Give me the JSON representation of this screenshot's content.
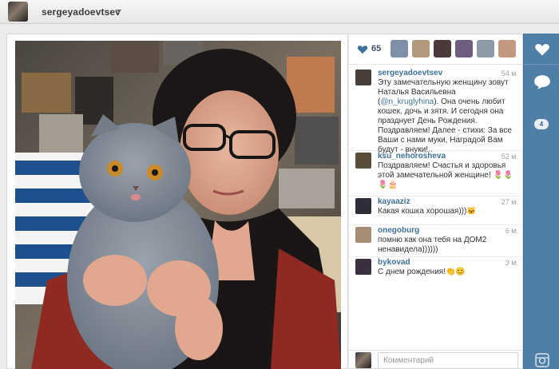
{
  "header": {
    "username": "sergeyadoevtsev"
  },
  "likes": {
    "count": "65",
    "likers": [
      {
        "color": "#7e8fa6"
      },
      {
        "color": "#b39a7c"
      },
      {
        "color": "#4c3a3a"
      },
      {
        "color": "#6f5d80"
      },
      {
        "color": "#8c9aa8"
      },
      {
        "color": "#c49880"
      },
      {
        "color": "#b36a58"
      },
      {
        "color": "#d9d9d9"
      }
    ]
  },
  "comments": [
    {
      "user": "sergeyadoevtsev",
      "time": "54 м.",
      "text_before": "Эту замечательную женщину зовут Наталья Васильевна (",
      "mention": "@n_kruglyhina",
      "text_after": "). Она очень любит кошек, дочь и зятя. И сегодня она празднует День Рождения. Поздравляем! Далее - стихи: За все Ваши с нами муки, Наградой Вам будут - внуки!..",
      "avatar_color": "#4a3f38"
    },
    {
      "user": "ksu_nehorosheva",
      "time": "52 м.",
      "text": "Поздравляем! Счастья и здоровья этой замечательной женщине! 🌷🌷🌷🎂",
      "avatar_color": "#5a4d3a"
    },
    {
      "user": "kayaaziz",
      "time": "27 м.",
      "text": "Какая кошка хорошая)))🐱",
      "avatar_color": "#2e2e3a"
    },
    {
      "user": "onegoburg",
      "time": "6 м.",
      "text": "помню как она тебя на ДОМ2 ненавидела))))))",
      "avatar_color": "#a58c72"
    },
    {
      "user": "bykovad",
      "time": "3 м.",
      "text": "С днем рождения!👏😊",
      "avatar_color": "#3a3040"
    }
  ],
  "comment_input": {
    "placeholder": "Комментарий"
  },
  "rail": {
    "comments_badge": "4"
  },
  "colors": {
    "rail": "#4f7fa7",
    "link": "#3f729b",
    "like_heart": "#3f729b"
  }
}
